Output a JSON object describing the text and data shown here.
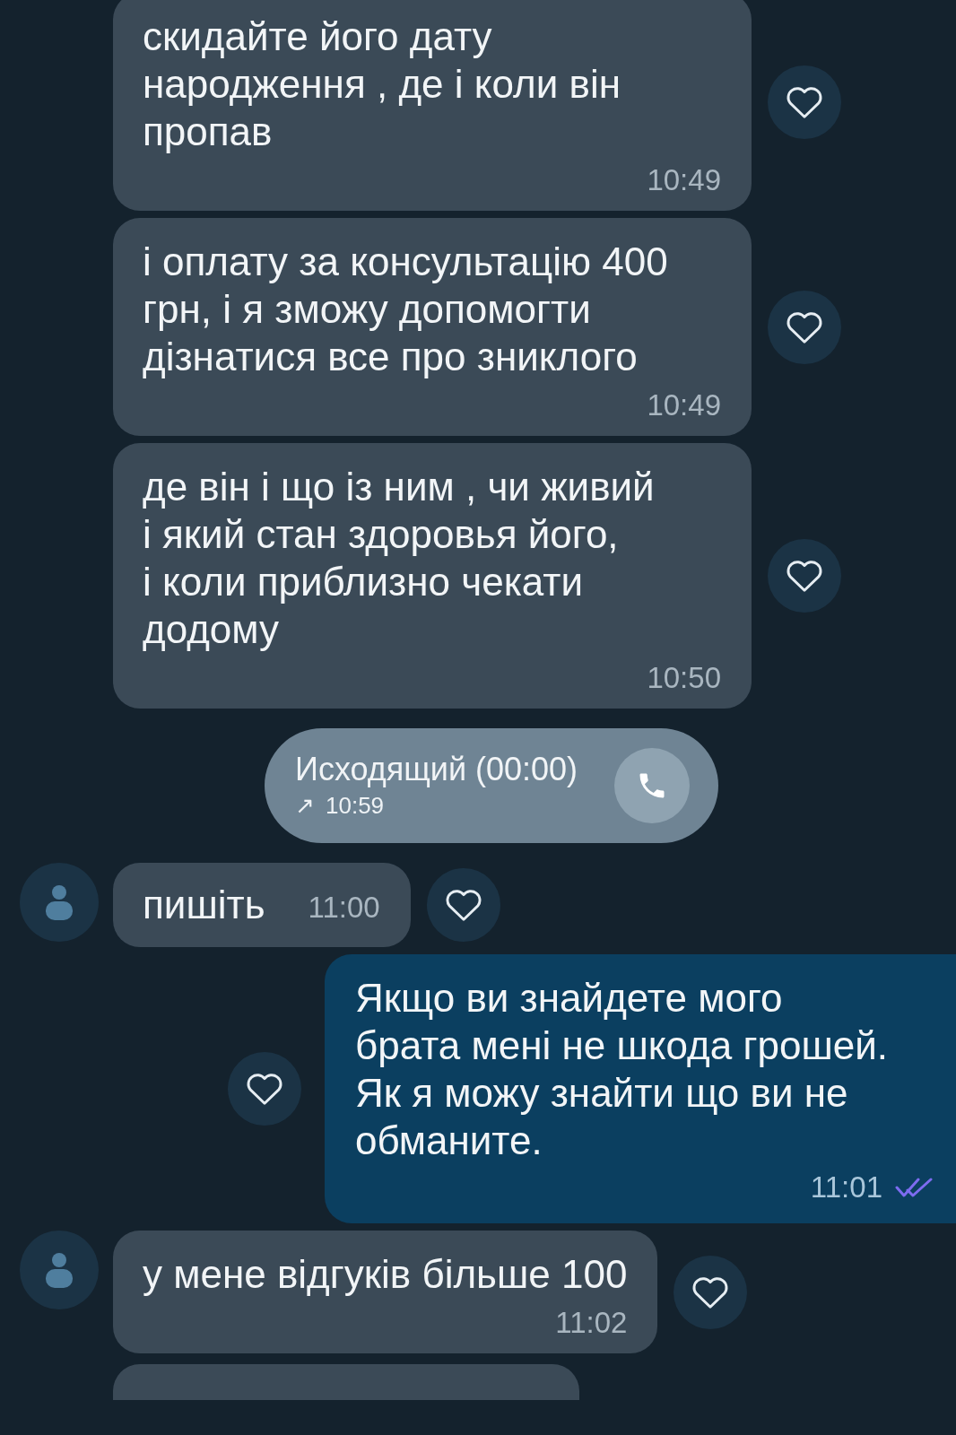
{
  "messages": [
    {
      "kind": "incoming",
      "text": "скидайте його дату\nнародження , де і коли він\nпропав",
      "time": "10:49",
      "avatar": false
    },
    {
      "kind": "incoming",
      "text": "і оплату за консультацію 400\nгрн, і я  зможу допомогти\nдізнатися все про зниклого",
      "time": "10:49",
      "avatar": false
    },
    {
      "kind": "incoming",
      "text": "де він і що із ним , чи живий\nі який стан здоровья його,\nі коли приблизно чекати\nдодому",
      "time": "10:50",
      "avatar": false
    },
    {
      "kind": "call",
      "text": "Исходящий (00:00)",
      "direction": "↗",
      "time": "10:59"
    },
    {
      "kind": "incoming_inline",
      "text": "пишіть",
      "time": "11:00",
      "avatar": true
    },
    {
      "kind": "outgoing",
      "text": "Якщо ви знайдете мого\nбрата мені не шкода грошей.\nЯк я можу знайти що ви не\nобманите.",
      "time": "11:01",
      "read": true
    },
    {
      "kind": "incoming",
      "text": "у мене відгуків більше 100",
      "time": "11:02",
      "avatar": true
    },
    {
      "kind": "partial"
    }
  ]
}
